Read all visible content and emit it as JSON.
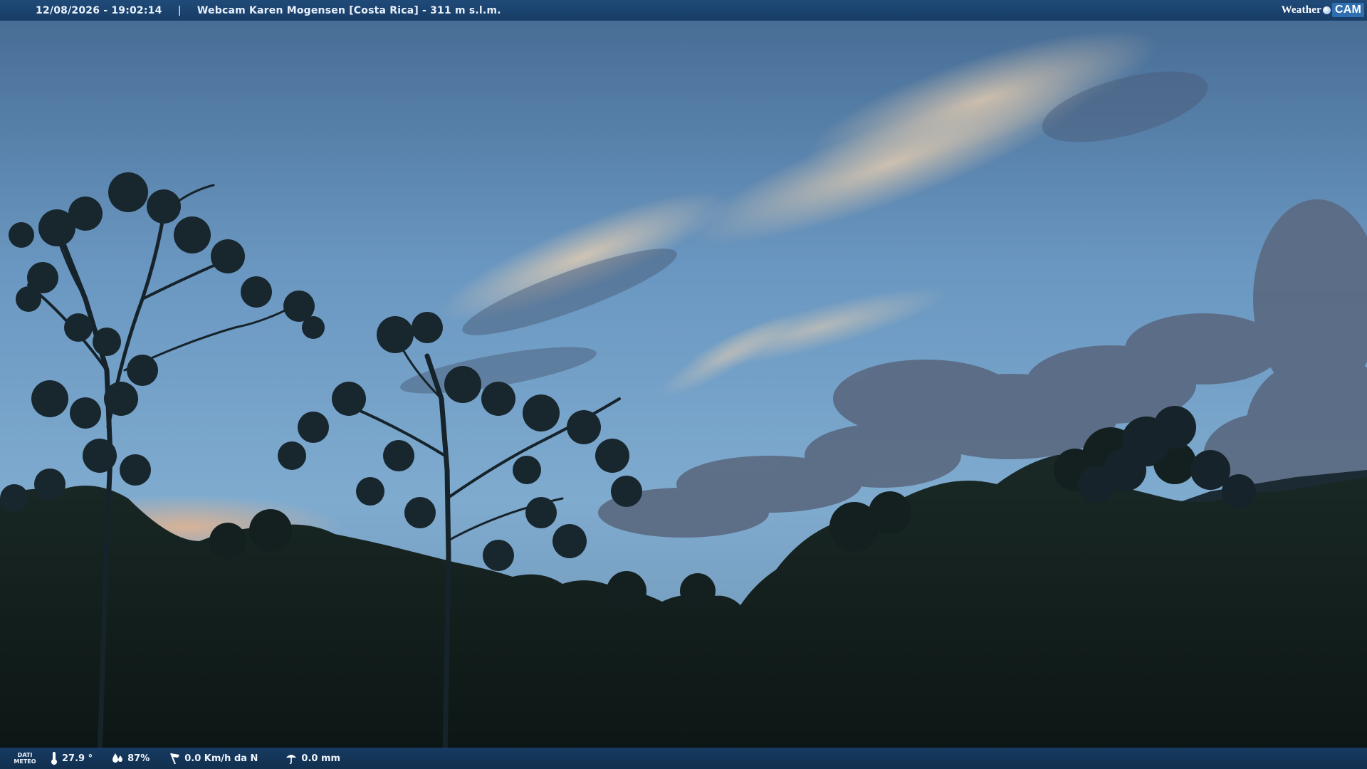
{
  "header": {
    "datetime": "12/08/2026 - 19:02:14",
    "separator": "|",
    "title": "Webcam Karen Mogensen [Costa Rica] - 311 m s.l.m.",
    "brand_weather": "Weather",
    "brand_cam": "CAM"
  },
  "footer": {
    "dati_line1": "DATI",
    "dati_line2": "METEO",
    "temperature": "27.9 °",
    "humidity": "87%",
    "wind": "0.0 Km/h da N",
    "rain": "0.0 mm"
  },
  "icons": {
    "temperature": "thermometer-icon",
    "humidity": "humidity-drops-icon",
    "wind": "wind-flag-icon",
    "rain": "umbrella-rain-icon"
  },
  "colors": {
    "bar_blue": "#1a4370",
    "sky_top": "#486f97",
    "sky_mid": "#7aa8cf",
    "sunset_glow": "#e2b38f",
    "foliage_dark": "#0f1a1a"
  }
}
